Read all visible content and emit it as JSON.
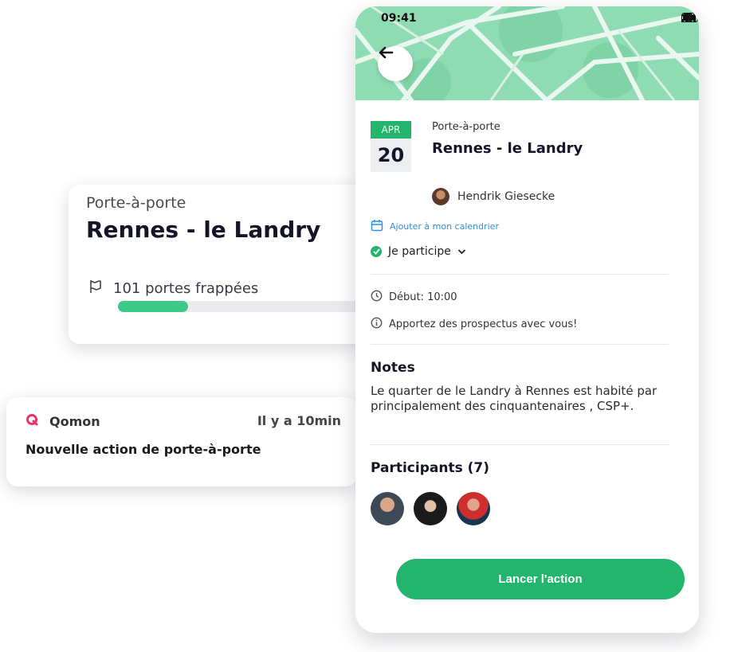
{
  "summary_card": {
    "type": "Porte-à-porte",
    "title": "Rennes - le Landry",
    "doors_text": "101 portes frappées",
    "progress": 0.26
  },
  "notification": {
    "app_name": "Qomon",
    "time": "Il y a 10min",
    "message": "Nouvelle action de porte-à-porte",
    "logo_color": "#e8356d"
  },
  "phone": {
    "status_time": "09:41",
    "event": {
      "month": "APR",
      "day": "20",
      "type": "Porte-à-porte",
      "title": "Rennes - le Landry",
      "organizer": "Hendrik Giesecke"
    },
    "add_calendar": "Ajouter à mon calendrier",
    "participation": "Je participe",
    "start": "Début: 10:00",
    "info": "Apportez des prospectus avec vous!",
    "notes_title": "Notes",
    "notes_body": "Le quarter de le Landry à Rennes est habité par principalement des cinquantenaires , CSP+.",
    "participants_title": "Participants (7)",
    "cta": "Lancer l'action"
  },
  "colors": {
    "accent": "#23b56d",
    "link": "#2d8fe0",
    "map": "#8fdcb4"
  }
}
